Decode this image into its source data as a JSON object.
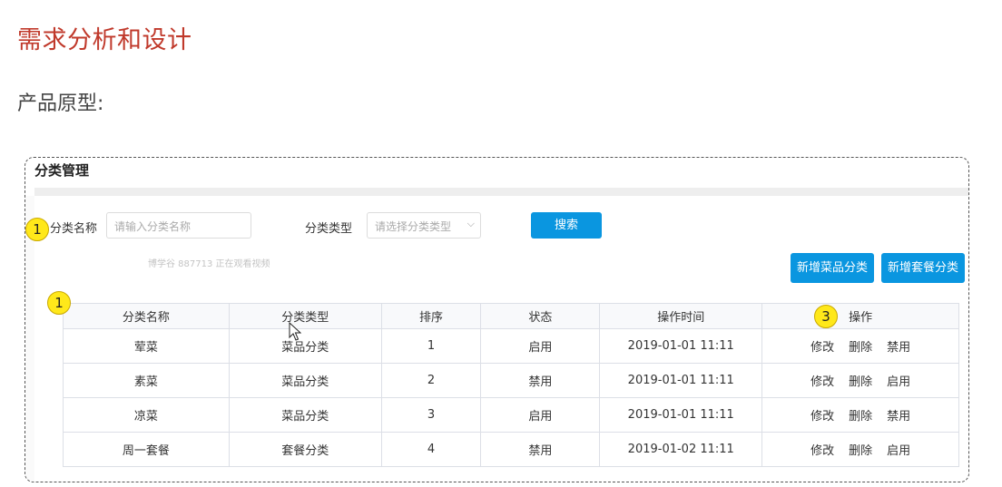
{
  "doc": {
    "heading": "需求分析和设计",
    "subheading": "产品原型:"
  },
  "panel": {
    "title": "分类管理",
    "search": {
      "name_label": "分类名称",
      "name_placeholder": "请输入分类名称",
      "type_label": "分类类型",
      "type_placeholder": "请选择分类类型",
      "search_button": "搜索"
    },
    "watermark": "博学谷 887713 正在观看视频",
    "actions": {
      "add_dish_category": "新增菜品分类",
      "add_setmeal_category": "新增套餐分类"
    },
    "badges": {
      "search": "1",
      "table": "1",
      "ops": "3"
    },
    "table": {
      "headers": [
        "分类名称",
        "分类类型",
        "排序",
        "状态",
        "操作时间",
        "操作"
      ],
      "rows": [
        {
          "name": "荤菜",
          "type": "菜品分类",
          "sort": "1",
          "status": "启用",
          "time": "2019-01-01 11:11",
          "edit": "修改",
          "delete": "删除",
          "toggle": "禁用"
        },
        {
          "name": "素菜",
          "type": "菜品分类",
          "sort": "2",
          "status": "禁用",
          "time": "2019-01-01 11:11",
          "edit": "修改",
          "delete": "删除",
          "toggle": "启用"
        },
        {
          "name": "凉菜",
          "type": "菜品分类",
          "sort": "3",
          "status": "启用",
          "time": "2019-01-01 11:11",
          "edit": "修改",
          "delete": "删除",
          "toggle": "禁用"
        },
        {
          "name": "周一套餐",
          "type": "套餐分类",
          "sort": "4",
          "status": "禁用",
          "time": "2019-01-02 11:11",
          "edit": "修改",
          "delete": "删除",
          "toggle": "启用"
        }
      ]
    }
  },
  "colors": {
    "heading": "#c0392b",
    "primary_button": "#0a96e0",
    "badge": "#ffe81a"
  }
}
